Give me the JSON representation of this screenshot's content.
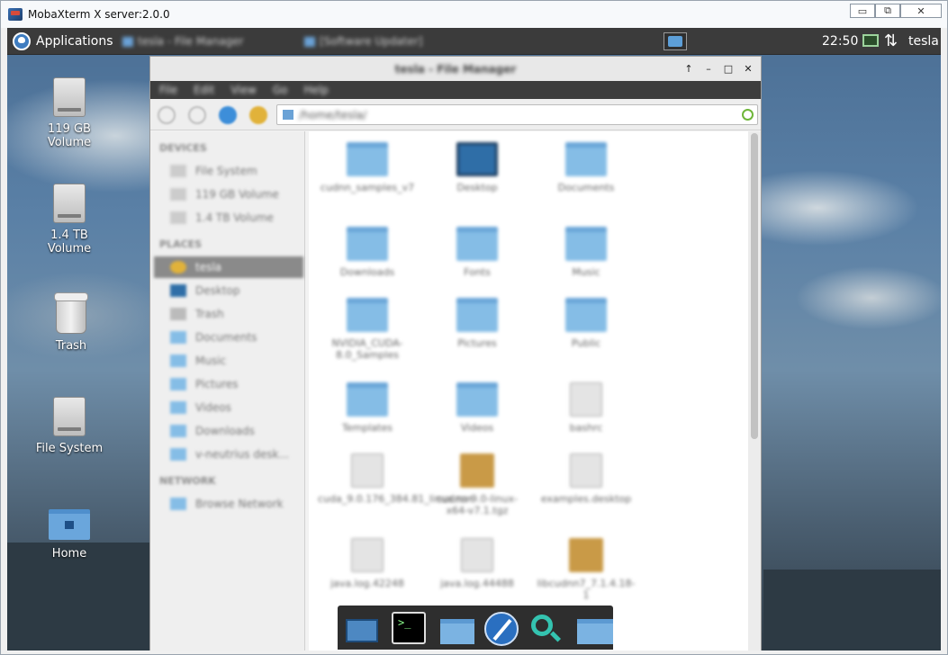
{
  "window": {
    "title": "MobaXterm X server:2.0.0",
    "buttons": {
      "minimize": "▭",
      "restore": "⧉",
      "close": "✕"
    }
  },
  "panel": {
    "applications_label": "Applications",
    "tasks": [
      "tesla - File Manager",
      "[Software Updater]"
    ],
    "clock": "22:50",
    "user": "tesla",
    "updown": "⇅"
  },
  "desktop_icons": [
    {
      "label_line1": "119 GB",
      "label_line2": "Volume",
      "icon": "drive-icon"
    },
    {
      "label_line1": "1.4 TB",
      "label_line2": "Volume",
      "icon": "drive-icon"
    },
    {
      "label_line1": "Trash",
      "label_line2": "",
      "icon": "trash-icon"
    },
    {
      "label_line1": "File System",
      "label_line2": "",
      "icon": "drive-icon"
    },
    {
      "label_line1": "Home",
      "label_line2": "",
      "icon": "home-folder-icon"
    }
  ],
  "file_manager": {
    "title": "tesla - File Manager",
    "menu": [
      "File",
      "Edit",
      "View",
      "Go",
      "Help"
    ],
    "location": "/home/tesla/",
    "title_buttons": {
      "up": "↑",
      "minimize": "–",
      "maximize": "□",
      "close": "✕"
    },
    "sidebar": {
      "devices_header": "DEVICES",
      "devices": [
        "File System",
        "119 GB Volume",
        "1.4 TB Volume"
      ],
      "places_header": "PLACES",
      "places": [
        "tesla",
        "Desktop",
        "Trash",
        "Documents",
        "Music",
        "Pictures",
        "Videos",
        "Downloads",
        "v-neutrius desk..."
      ],
      "network_header": "NETWORK",
      "network": [
        "Browse Network"
      ]
    },
    "files": [
      {
        "name": "cudnn_samples_v7",
        "kind": "folder"
      },
      {
        "name": "Desktop",
        "kind": "desktop"
      },
      {
        "name": "Documents",
        "kind": "folder"
      },
      {
        "name": "Downloads",
        "kind": "folder"
      },
      {
        "name": "Fonts",
        "kind": "folder"
      },
      {
        "name": "Music",
        "kind": "folder"
      },
      {
        "name": "NVIDIA_CUDA-8.0_Samples",
        "kind": "folder"
      },
      {
        "name": "Pictures",
        "kind": "folder"
      },
      {
        "name": "Public",
        "kind": "folder"
      },
      {
        "name": "Templates",
        "kind": "folder"
      },
      {
        "name": "Videos",
        "kind": "folder"
      },
      {
        "name": "bashrc",
        "kind": "doc"
      },
      {
        "name": "cuda_9.0.176_384.81_linux.run",
        "kind": "doc"
      },
      {
        "name": "cudnn-9.0-linux-x64-v7.1.tgz",
        "kind": "archive"
      },
      {
        "name": "examples.desktop",
        "kind": "doc"
      },
      {
        "name": "java.log.42248",
        "kind": "doc"
      },
      {
        "name": "java.log.44488",
        "kind": "doc"
      },
      {
        "name": "libcudnn7_7.1.4.18-1",
        "kind": "archive"
      }
    ],
    "overlap_text": "nd6"
  },
  "dock": {
    "terminal_glyph": ">_"
  }
}
